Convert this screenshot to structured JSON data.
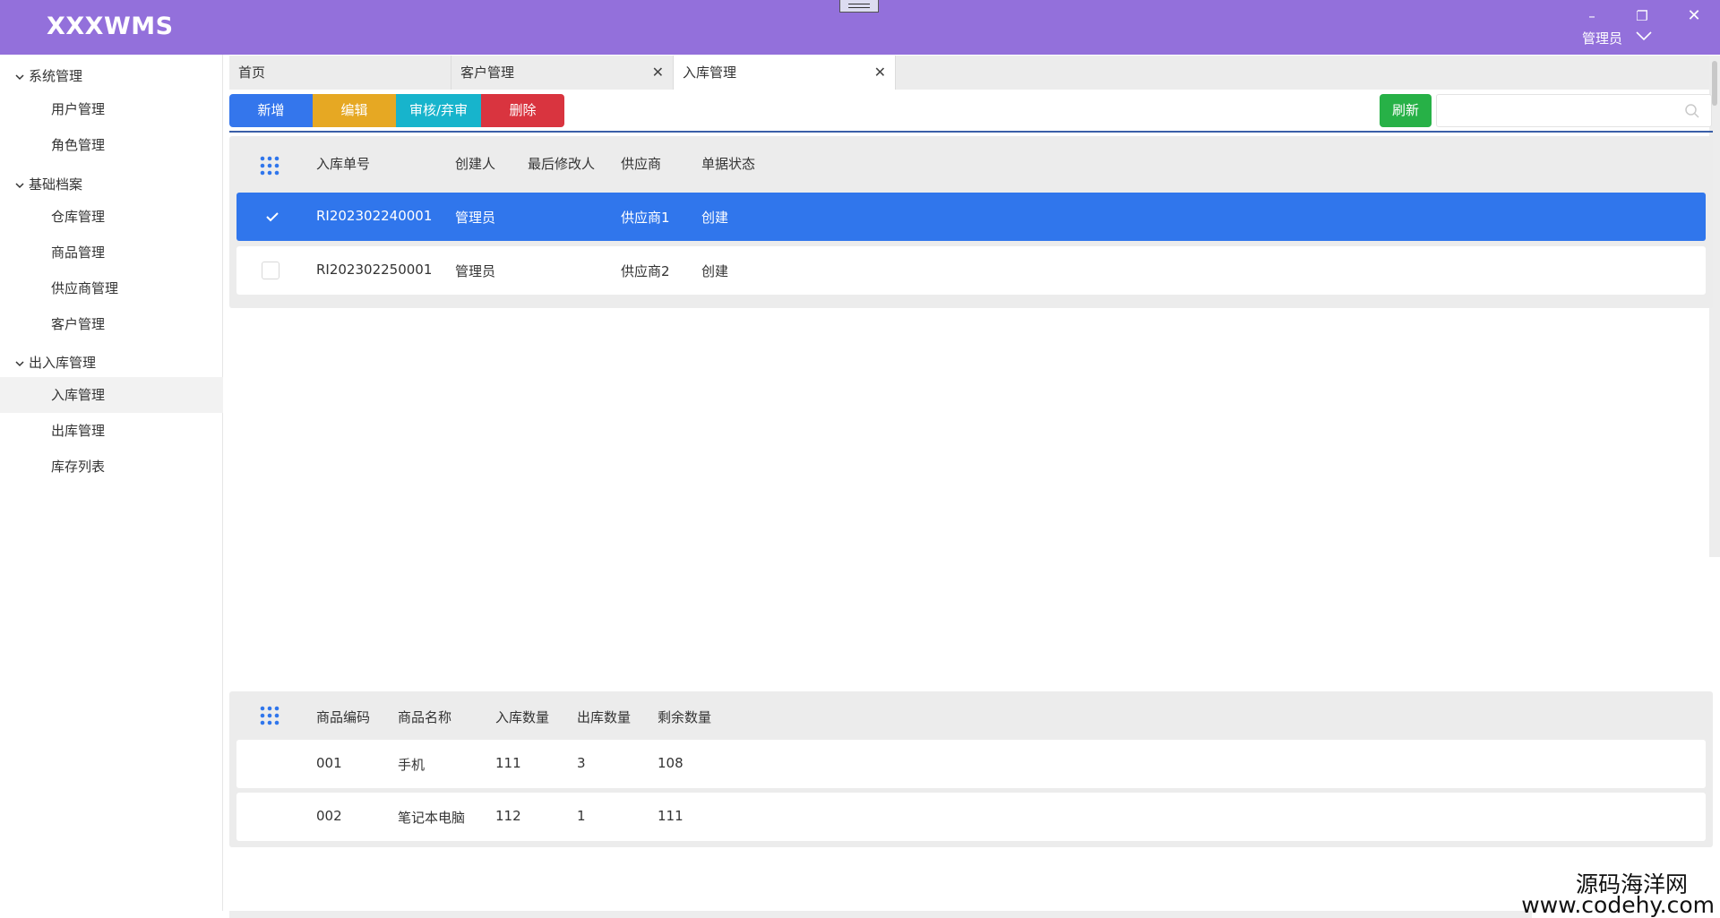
{
  "app": {
    "title": "XXXWMS",
    "user": "管理员"
  },
  "window": {
    "minimize": "–",
    "maximize": "❐",
    "close": "✕"
  },
  "sidebar": {
    "groups": [
      {
        "label": "系统管理",
        "items": [
          "用户管理",
          "角色管理"
        ]
      },
      {
        "label": "基础档案",
        "items": [
          "仓库管理",
          "商品管理",
          "供应商管理",
          "客户管理"
        ]
      },
      {
        "label": "出入库管理",
        "items": [
          "入库管理",
          "出库管理",
          "库存列表"
        ]
      }
    ],
    "active_item": "入库管理"
  },
  "tabs": [
    {
      "label": "首页",
      "closable": false
    },
    {
      "label": "客户管理",
      "closable": true
    },
    {
      "label": "入库管理",
      "closable": true,
      "active": true
    }
  ],
  "tab_close_glyph": "✕",
  "toolbar": {
    "add": "新增",
    "edit": "编辑",
    "audit": "审核/弃审",
    "delete": "删除",
    "refresh": "刷新",
    "search_placeholder": ""
  },
  "colors": {
    "titlebar": "#9370db",
    "add": "#3476ec",
    "edit": "#e6a823",
    "audit": "#17b4cc",
    "delete": "#d9343f",
    "refresh": "#27b147",
    "selected_row": "#3076ec"
  },
  "orders_table": {
    "columns": [
      "入库单号",
      "创建人",
      "最后修改人",
      "供应商",
      "单据状态"
    ],
    "rows": [
      {
        "selected": true,
        "order_no": "RI202302240001",
        "creator": "管理员",
        "modifier": "",
        "supplier": "供应商1",
        "status": "创建"
      },
      {
        "selected": false,
        "order_no": "RI202302250001",
        "creator": "管理员",
        "modifier": "",
        "supplier": "供应商2",
        "status": "创建"
      }
    ]
  },
  "items_table": {
    "columns": [
      "商品编码",
      "商品名称",
      "入库数量",
      "出库数量",
      "剩余数量"
    ],
    "rows": [
      {
        "code": "001",
        "name": "手机",
        "in_qty": "111",
        "out_qty": "3",
        "remain_qty": "108"
      },
      {
        "code": "002",
        "name": "笔记本电脑",
        "in_qty": "112",
        "out_qty": "1",
        "remain_qty": "111"
      }
    ]
  },
  "watermark": {
    "line1": "源码海洋网",
    "line2": "www.codehy.com"
  }
}
